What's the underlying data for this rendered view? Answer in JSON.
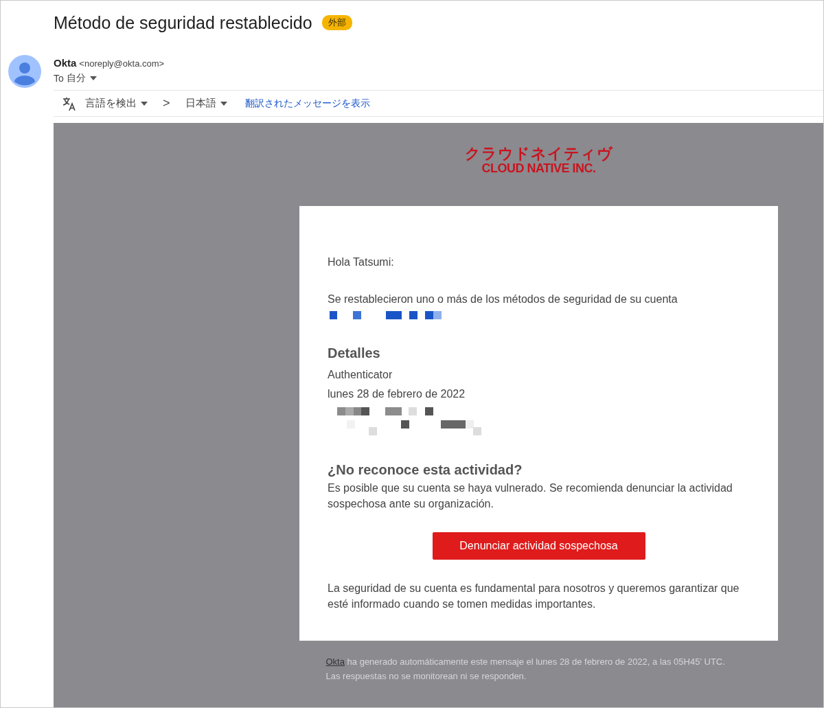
{
  "subject": "Método de seguridad restablecido",
  "label": "外部",
  "sender": {
    "name": "Okta",
    "address": "<noreply@okta.com>",
    "to_prefix": "To",
    "to": "自分"
  },
  "translate_bar": {
    "source": "言語を検出",
    "arrow": ">",
    "target": "日本語",
    "link": "翻訳されたメッセージを表示"
  },
  "logo": {
    "line_1": "クラウドネイティヴ",
    "line_2": "CLOUD NATIVE INC."
  },
  "card": {
    "greeting": "Hola Tatsumi:",
    "intro": "Se restablecieron uno o más de los métodos de seguridad de su cuenta",
    "details_heading": "Detalles",
    "details": [
      "Authenticator",
      "lunes 28 de febrero de 2022"
    ],
    "question_heading": "¿No reconoce esta actividad?",
    "question_text": "Es posible que su cuenta se haya vulnerado. Se recomienda denunciar la actividad sospechosa ante su organización.",
    "button": "Denunciar actividad sospechosa",
    "closing": "La seguridad de su cuenta es fundamental para nosotros y queremos garantizar que esté informado cuando se tomen medidas importantes."
  },
  "footer": {
    "link": "Okta",
    "text": " ha generado automáticamente este mensaje el lunes 28 de febrero de 2022, a las 05H45' UTC.",
    "line_2": "Las respuestas no se monitorean ni se responden."
  }
}
